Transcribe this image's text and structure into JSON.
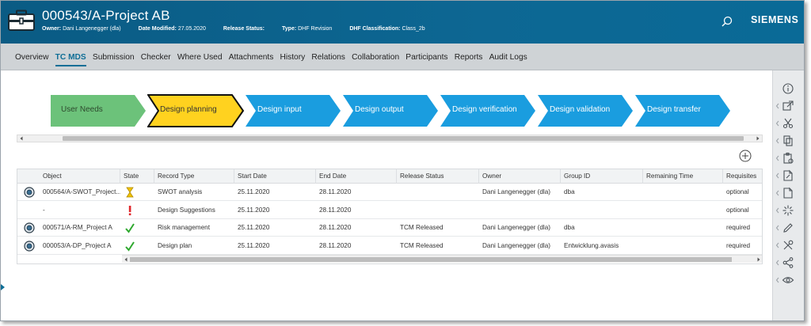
{
  "header": {
    "title": "000543/A-Project AB",
    "meta": [
      {
        "label": "Owner:",
        "value": "Dani Langenegger (dla)"
      },
      {
        "label": "Date Modified:",
        "value": "27.05.2020"
      },
      {
        "label": "Release Status:",
        "value": ""
      },
      {
        "label": "Type:",
        "value": "DHF Revision"
      },
      {
        "label": "DHF Classification:",
        "value": "Class_2b"
      }
    ],
    "brand": "SIEMENS",
    "icons": {
      "app": "briefcase-icon",
      "search": "search-icon"
    }
  },
  "tabs": [
    {
      "label": "Overview",
      "active": false
    },
    {
      "label": "TC MDS",
      "active": true
    },
    {
      "label": "Submission",
      "active": false
    },
    {
      "label": "Checker",
      "active": false
    },
    {
      "label": "Where Used",
      "active": false
    },
    {
      "label": "Attachments",
      "active": false
    },
    {
      "label": "History",
      "active": false
    },
    {
      "label": "Relations",
      "active": false
    },
    {
      "label": "Collaboration",
      "active": false
    },
    {
      "label": "Participants",
      "active": false
    },
    {
      "label": "Reports",
      "active": false
    },
    {
      "label": "Audit Logs",
      "active": false
    }
  ],
  "process": {
    "steps": [
      {
        "label": "User Needs",
        "state": "done"
      },
      {
        "label": "Design planning",
        "state": "current"
      },
      {
        "label": "Design input",
        "state": "pending"
      },
      {
        "label": "Design output",
        "state": "pending"
      },
      {
        "label": "Design verification",
        "state": "pending"
      },
      {
        "label": "Design validation",
        "state": "pending"
      },
      {
        "label": "Design transfer",
        "state": "pending"
      }
    ],
    "colors": {
      "done": "#6cc27a",
      "current": "#ffd21f",
      "pending": "#1a9ddf",
      "current_border": "#111111",
      "done_text": "#2e4a2e",
      "pending_text": "#ffffff",
      "current_text": "#333333"
    }
  },
  "table": {
    "columns": [
      "Object",
      "State",
      "Record Type",
      "Start Date",
      "End Date",
      "Release Status",
      "Owner",
      "Group ID",
      "Remaining Time",
      "Requisites"
    ],
    "rows": [
      {
        "has_icon": true,
        "object": "000564/A-SWOT_Project...",
        "state_icon": "hourglass-icon",
        "record_type": "SWOT analysis",
        "start": "25.11.2020",
        "end": "28.11.2020",
        "release_status": "",
        "owner": "Dani Langenegger (dla)",
        "group": "dba",
        "remaining": "",
        "requisites": "optional"
      },
      {
        "has_icon": false,
        "object": "-",
        "state_icon": "exclamation-icon",
        "record_type": "Design Suggestions",
        "start": "25.11.2020",
        "end": "28.11.2020",
        "release_status": "",
        "owner": "",
        "group": "",
        "remaining": "",
        "requisites": "optional"
      },
      {
        "has_icon": true,
        "object": "000571/A-RM_Project A",
        "state_icon": "checkmark-icon",
        "record_type": "Risk management",
        "start": "25.11.2020",
        "end": "28.11.2020",
        "release_status": "TCM Released",
        "owner": "Dani Langenegger (dla)",
        "group": "dba",
        "remaining": "",
        "requisites": "required"
      },
      {
        "has_icon": true,
        "object": "000053/A-DP_Project A",
        "state_icon": "checkmark-icon",
        "record_type": "Design plan",
        "start": "25.11.2020",
        "end": "28.11.2020",
        "release_status": "TCM Released",
        "owner": "Dani Langenegger (dla)",
        "group": "Entwicklung.avasis",
        "remaining": "",
        "requisites": "required"
      }
    ]
  },
  "sidebar_icons": [
    "info-icon",
    "open-external-icon",
    "cut-icon",
    "copy-icon",
    "paste-special-icon",
    "document-edit-icon",
    "document-icon",
    "sparkle-icon",
    "pencil-icon",
    "tools-icon",
    "share-icon",
    "eye-icon"
  ],
  "accent": "#0e6e96"
}
